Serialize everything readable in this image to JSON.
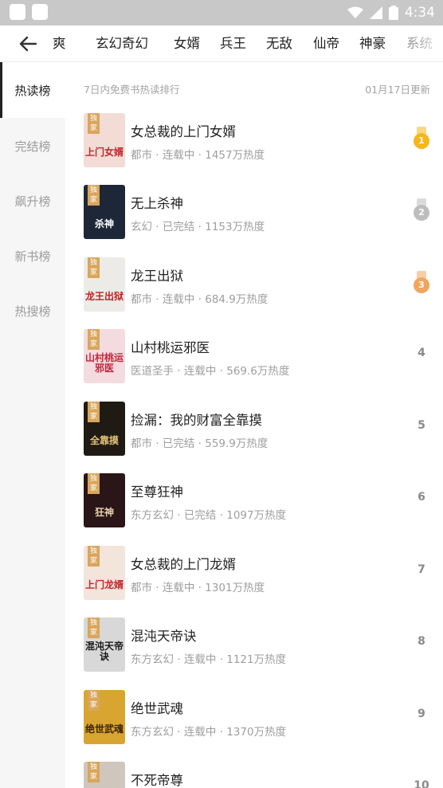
{
  "status_bar": {
    "time": "4:34"
  },
  "categories": [
    {
      "label": "爽",
      "faded": false
    },
    {
      "label": "玄幻奇幻",
      "faded": false
    },
    {
      "label": "女婿",
      "faded": false
    },
    {
      "label": "兵王",
      "faded": false
    },
    {
      "label": "无敌",
      "faded": false
    },
    {
      "label": "仙帝",
      "faded": false
    },
    {
      "label": "神豪",
      "faded": false
    },
    {
      "label": "系统",
      "faded": true
    }
  ],
  "sidebar": {
    "items": [
      {
        "label": "热读榜",
        "active": true
      },
      {
        "label": "完结榜",
        "active": false
      },
      {
        "label": "飙升榜",
        "active": false
      },
      {
        "label": "新书榜",
        "active": false
      },
      {
        "label": "热搜榜",
        "active": false
      }
    ]
  },
  "list_header": {
    "left": "7日内免费书热读排行",
    "right": "01月17日更新"
  },
  "books": [
    {
      "title": "女总裁的上门女婿",
      "meta": "都市 · 连载中 · 1457万热度",
      "rank": "1",
      "tag": "独家",
      "cover_text": "上门女婿",
      "cover_bg": "#f3dcd6",
      "cover_fg": "#c0262e"
    },
    {
      "title": "无上杀神",
      "meta": "玄幻 · 已完结 · 1153万热度",
      "rank": "2",
      "tag": "独家",
      "cover_text": "杀神",
      "cover_bg": "#1d2738",
      "cover_fg": "#ffffff"
    },
    {
      "title": "龙王出狱",
      "meta": "都市 · 连载中 · 684.9万热度",
      "rank": "3",
      "tag": "独家",
      "cover_text": "龙王出狱",
      "cover_bg": "#ecebe8",
      "cover_fg": "#c21d1d"
    },
    {
      "title": "山村桃运邪医",
      "meta": "医道圣手 · 连载中 · 569.6万热度",
      "rank": "4",
      "tag": "独家",
      "cover_text": "山村桃运邪医",
      "cover_bg": "#f4dbe0",
      "cover_fg": "#c0263a"
    },
    {
      "title": "捡漏：我的财富全靠摸",
      "meta": "都市 · 已完结 · 559.9万热度",
      "rank": "5",
      "tag": "独家",
      "cover_text": "全靠摸",
      "cover_bg": "#1f1b14",
      "cover_fg": "#e6c27a"
    },
    {
      "title": "至尊狂神",
      "meta": "东方玄幻 · 已完结 · 1097万热度",
      "rank": "6",
      "tag": "独家",
      "cover_text": "狂神",
      "cover_bg": "#2a1518",
      "cover_fg": "#e7d1b0"
    },
    {
      "title": "女总裁的上门龙婿",
      "meta": "都市 · 连载中 · 1301万热度",
      "rank": "7",
      "tag": "独家",
      "cover_text": "上门龙婿",
      "cover_bg": "#f3e4dc",
      "cover_fg": "#c0262e"
    },
    {
      "title": "混沌天帝诀",
      "meta": "东方玄幻 · 连载中 · 1121万热度",
      "rank": "8",
      "tag": "独家",
      "cover_text": "混沌天帝诀",
      "cover_bg": "#d8d8d8",
      "cover_fg": "#1a1a1a"
    },
    {
      "title": "绝世武魂",
      "meta": "东方玄幻 · 连载中 · 1370万热度",
      "rank": "9",
      "tag": "独家",
      "cover_text": "绝世武魂",
      "cover_bg": "#d9a531",
      "cover_fg": "#3a2408"
    },
    {
      "title": "不死帝尊",
      "meta": "",
      "rank": "10",
      "tag": "独家",
      "cover_text": "",
      "cover_bg": "#cfc6bd",
      "cover_fg": "#2b2b2b"
    }
  ],
  "colors": {
    "medal_gold": "#f5b71c",
    "medal_silver": "#bdbdbd",
    "medal_bronze": "#f0a65d",
    "tag_bg": "#d9a65c"
  }
}
